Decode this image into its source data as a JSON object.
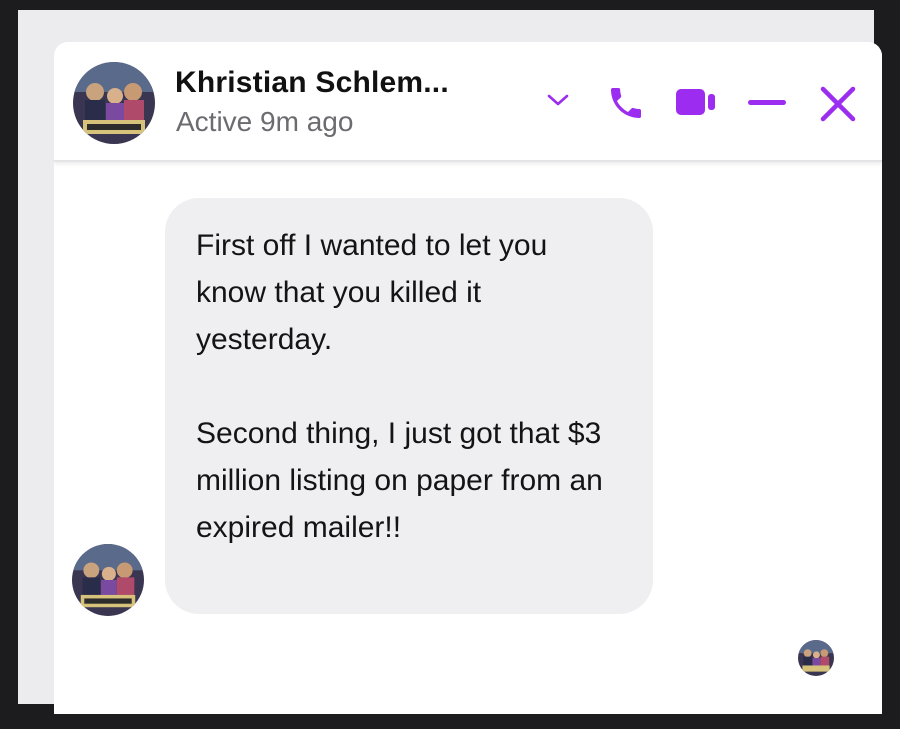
{
  "header": {
    "contact_name": "Khristian Schlem...",
    "status": "Active 9m ago",
    "accent_color": "#9b2cf0",
    "icons": {
      "options": "chevron-down-icon",
      "call": "phone-icon",
      "video": "video-camera-icon",
      "minimize": "minimize-icon",
      "close": "close-icon"
    }
  },
  "messages": [
    {
      "from": "contact",
      "paragraphs": [
        "First off I wanted to let you know that you killed it yesterday.",
        "Second thing, I just got that $3 million listing on paper from an expired mailer!!"
      ]
    }
  ]
}
